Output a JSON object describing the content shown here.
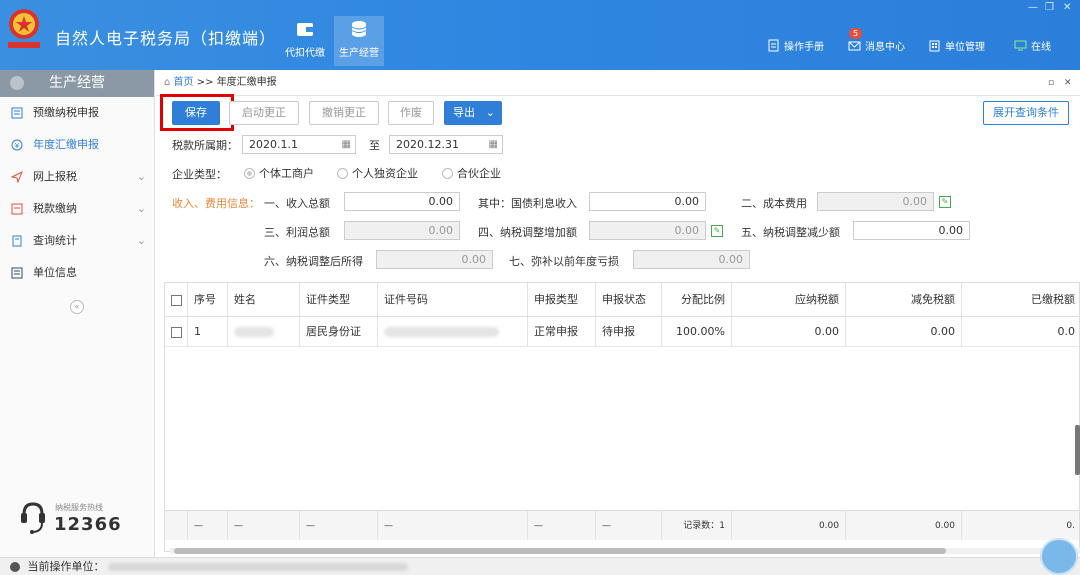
{
  "app": {
    "title": "自然人电子税务局（扣缴端）",
    "emblem_text": "中国税务"
  },
  "module_tabs": [
    {
      "label": "代扣代缴"
    },
    {
      "label": "生产经营"
    }
  ],
  "top_links": {
    "manual": "操作手册",
    "messages": "消息中心",
    "message_count": "5",
    "unit_mgmt": "单位管理",
    "online": "在线"
  },
  "window_controls": {
    "minimize": "—",
    "restore": "❐",
    "close": "✕"
  },
  "sidebar": {
    "header": "生产经营",
    "items": [
      {
        "label": "预缴纳税申报"
      },
      {
        "label": "年度汇缴申报"
      },
      {
        "label": "网上报税"
      },
      {
        "label": "税款缴纳"
      },
      {
        "label": "查询统计"
      },
      {
        "label": "单位信息"
      }
    ],
    "hotline_label": "纳税服务热线",
    "hotline_number": "12366"
  },
  "breadcrumb": {
    "home": "首页",
    "separator": ">>",
    "current": "年度汇缴申报"
  },
  "toolbar": {
    "save": "保存",
    "start_correction": "启动更正",
    "cancel_correction": "撤销更正",
    "void": "作废",
    "export": "导出",
    "expand_query": "展开查询条件"
  },
  "form": {
    "period_label": "税款所属期：",
    "period_from": "2020.1.1",
    "period_to_label": "至",
    "period_to": "2020.12.31",
    "enterprise_type_label": "企业类型：",
    "enterprise_types": [
      "个体工商户",
      "个人独资企业",
      "合伙企业"
    ],
    "income_section_label": "收入、费用信息：",
    "fields": {
      "total_income_label": "一、收入总额",
      "total_income": "0.00",
      "treasury_interest_label": "其中：国债利息收入",
      "treasury_interest": "0.00",
      "cost_label": "二、成本费用",
      "cost": "0.00",
      "total_profit_label": "三、利润总额",
      "total_profit": "0.00",
      "adj_increase_label": "四、纳税调整增加额",
      "adj_increase": "0.00",
      "adj_decrease_label": "五、纳税调整减少额",
      "adj_decrease": "0.00",
      "adjusted_income_label": "六、纳税调整后所得",
      "adjusted_income": "0.00",
      "prior_loss_label": "七、弥补以前年度亏损",
      "prior_loss": "0.00"
    }
  },
  "table": {
    "headers": [
      "序号",
      "姓名",
      "证件类型",
      "证件号码",
      "申报类型",
      "申报状态",
      "分配比例",
      "应纳税额",
      "减免税额",
      "已缴税额"
    ],
    "rows": [
      {
        "index": "1",
        "id_type": "居民身份证",
        "declare_type": "正常申报",
        "declare_status": "待申报",
        "ratio": "100.00%",
        "tax_payable": "0.00",
        "tax_reduction": "0.00",
        "tax_paid": "0.0"
      }
    ],
    "footer": {
      "dash": "—",
      "record_count": "记录数：1",
      "tax_payable": "0.00",
      "tax_reduction": "0.00",
      "tax_paid": "0."
    }
  },
  "status_bar": {
    "label": "当前操作单位："
  }
}
